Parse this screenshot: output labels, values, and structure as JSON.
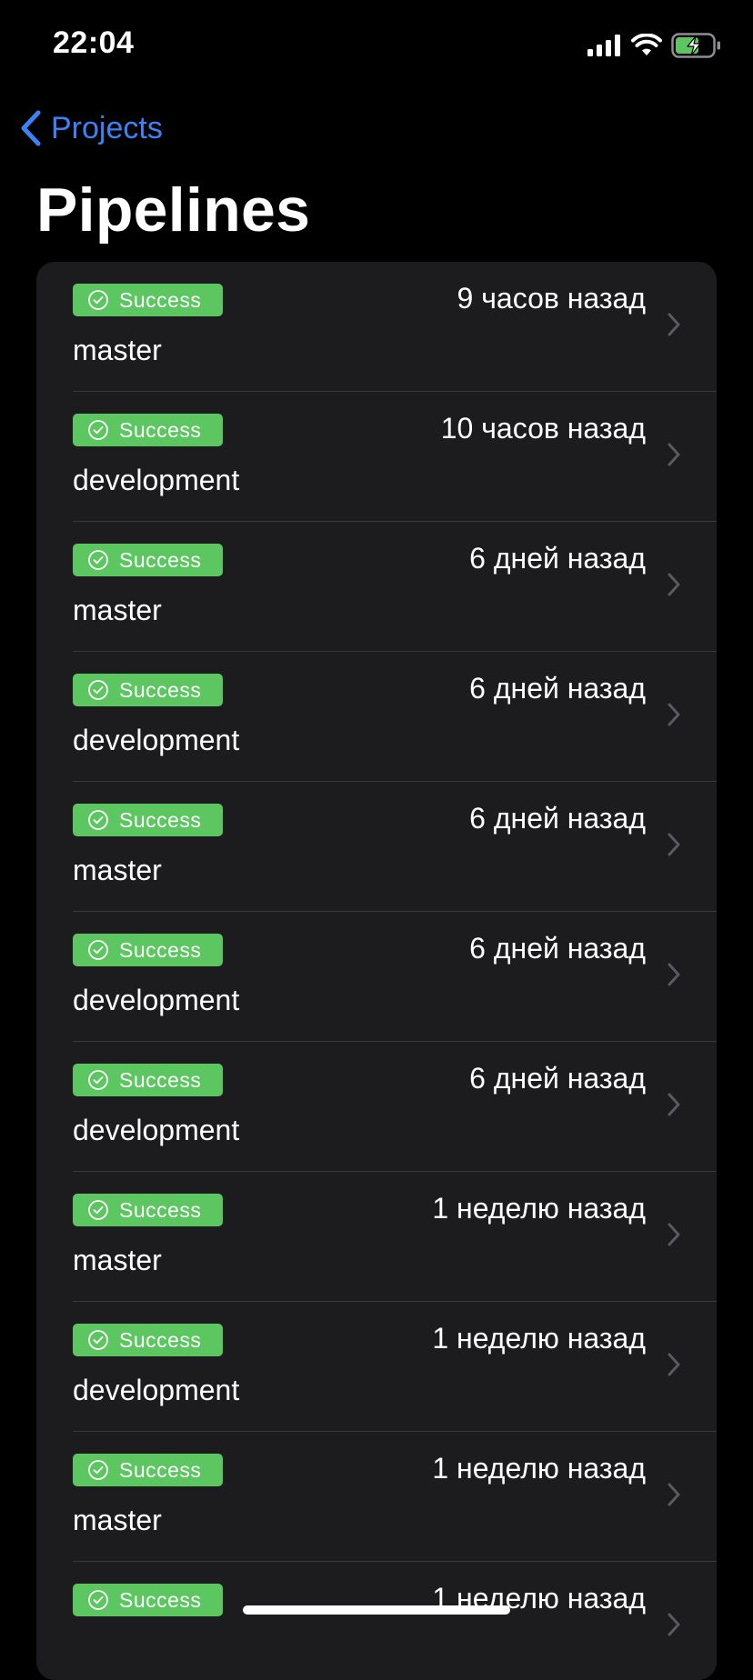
{
  "status_bar": {
    "time": "22:04"
  },
  "nav": {
    "back_label": "Projects",
    "title": "Pipelines"
  },
  "colors": {
    "accent": "#3b82f6",
    "success": "#5cc660",
    "background": "#000000",
    "card": "#1c1c1e"
  },
  "icons": {
    "back": "chevron-left-icon",
    "status": "checkmark-circle-icon",
    "row": "chevron-right-icon"
  },
  "pipelines": [
    {
      "status": "Success",
      "time": "9 часов назад",
      "branch": "master"
    },
    {
      "status": "Success",
      "time": "10 часов назад",
      "branch": "development"
    },
    {
      "status": "Success",
      "time": "6 дней назад",
      "branch": "master"
    },
    {
      "status": "Success",
      "time": "6 дней назад",
      "branch": "development"
    },
    {
      "status": "Success",
      "time": "6 дней назад",
      "branch": "master"
    },
    {
      "status": "Success",
      "time": "6 дней назад",
      "branch": "development"
    },
    {
      "status": "Success",
      "time": "6 дней назад",
      "branch": "development"
    },
    {
      "status": "Success",
      "time": "1 неделю назад",
      "branch": "master"
    },
    {
      "status": "Success",
      "time": "1 неделю назад",
      "branch": "development"
    },
    {
      "status": "Success",
      "time": "1 неделю назад",
      "branch": "master"
    },
    {
      "status": "Success",
      "time": "1 неделю назад",
      "branch": ""
    }
  ]
}
